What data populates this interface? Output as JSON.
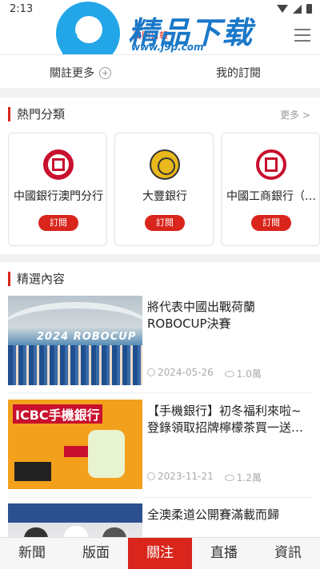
{
  "status_bar": {
    "time": "2:13"
  },
  "header": {
    "brand": "精品下载",
    "site": "www.j9p.com",
    "red_text": "澳門日報"
  },
  "subtabs": {
    "follow_more": "關註更多",
    "my_subscriptions": "我的訂閱"
  },
  "hot_categories": {
    "title": "熱門分類",
    "more": "更多 >",
    "items": [
      {
        "name": "中國銀行澳門分行",
        "button": "訂閱"
      },
      {
        "name": "大豐銀行",
        "button": "訂閱"
      },
      {
        "name": "中國工商銀行（…",
        "button": "訂閱"
      }
    ]
  },
  "featured": {
    "title": "精選內容",
    "articles": [
      {
        "title": "將代表中國出戰荷蘭ROBOCUP決賽",
        "date": "2024-05-26",
        "views": "1.0萬",
        "thumb_text": "2024 ROBOCUP"
      },
      {
        "title": "【手機銀行】初冬福利來啦~登錄領取招牌檸檬茶買一送…",
        "date": "2023-11-21",
        "views": "1.2萬",
        "thumb_text": "ICBC手機銀行"
      },
      {
        "title": "全澳柔道公開賽滿載而歸",
        "date": "",
        "views": "",
        "thumb_text": ""
      }
    ]
  },
  "bottom_nav": {
    "items": [
      "新聞",
      "版面",
      "關注",
      "直播",
      "資訊"
    ],
    "active": "關注"
  },
  "colors": {
    "accent_red": "#d9251c",
    "brand_blue": "#22a6e8"
  }
}
